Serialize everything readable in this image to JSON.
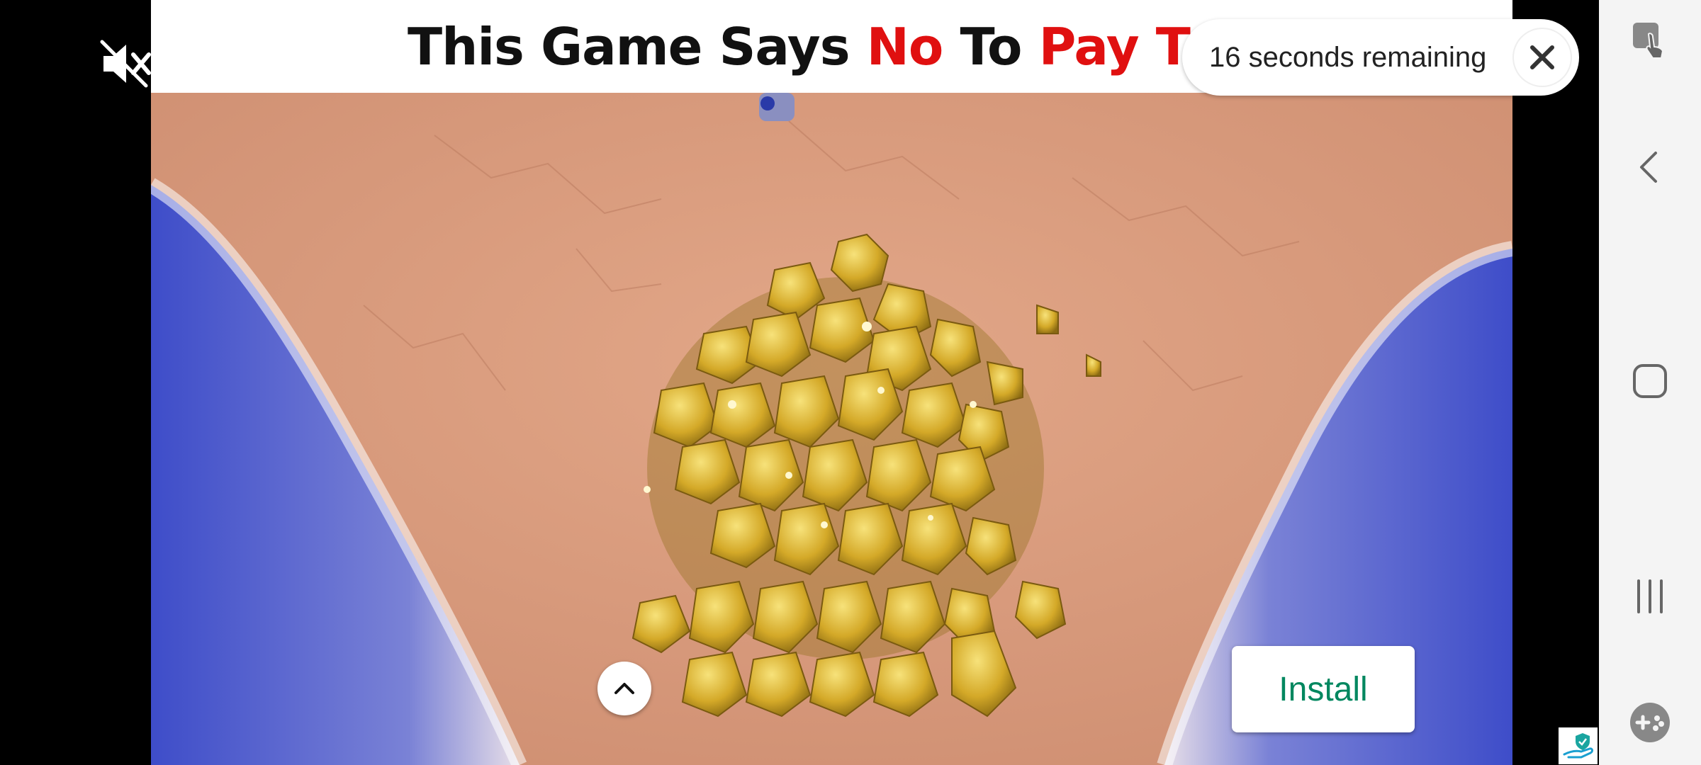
{
  "banner": {
    "part1": "This Game Says ",
    "part2": "No",
    "part3": " To ",
    "part4": "Pay To W"
  },
  "ad": {
    "timer_text": "16 seconds remaining",
    "install_label": "Install",
    "mute_icon": "volume-muted-icon",
    "close_icon": "close-icon",
    "expand_icon": "chevron-up-icon",
    "badge_icon": "ad-choices-hand-shield-icon"
  },
  "navbar": {
    "icons": [
      "screen-touch-icon",
      "back-icon",
      "home-icon",
      "recent-apps-icon",
      "game-launcher-icon"
    ]
  },
  "colors": {
    "accent_red": "#e01010",
    "install_green": "#01875f",
    "sand": "#d99a7c",
    "water": "#5a63c8",
    "gold": "#d4a928"
  }
}
